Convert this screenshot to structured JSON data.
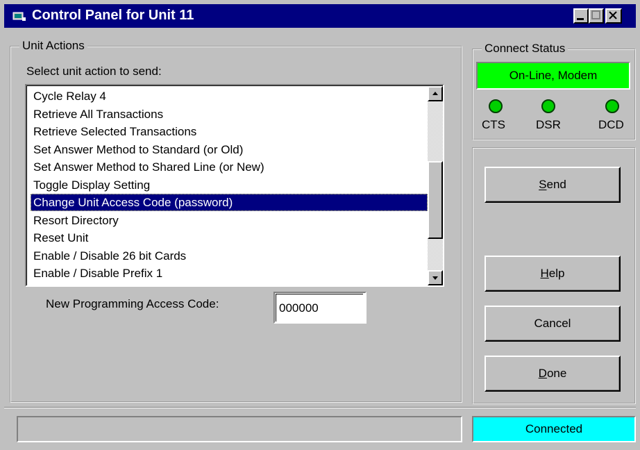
{
  "window": {
    "title": "Control Panel for Unit 11"
  },
  "unit_actions": {
    "group_label": "Unit Actions",
    "prompt": "Select unit action to send:",
    "items": [
      "Cycle Relay 4",
      "Retrieve All Transactions",
      "Retrieve Selected Transactions",
      "Set Answer Method to Standard (or Old)",
      "Set Answer Method to Shared Line (or New)",
      "Toggle Display Setting",
      "Change Unit Access Code (password)",
      "Resort Directory",
      "Reset Unit",
      "Enable / Disable 26 bit Cards",
      "Enable / Disable Prefix 1"
    ],
    "selected_index": 6,
    "access_code_label": "New Programming Access Code:",
    "access_code_value": "000000"
  },
  "connect_status": {
    "group_label": "Connect Status",
    "status_text": "On-Line, Modem",
    "status_color": "#00ff00",
    "indicators": [
      "CTS",
      "DSR",
      "DCD"
    ],
    "indicator_color": "#00d000"
  },
  "buttons": {
    "send": "Send",
    "help": "Help",
    "cancel": "Cancel",
    "done": "Done"
  },
  "statusbar": {
    "left_text": "",
    "right_text": "Connected",
    "right_color": "#00ffff"
  }
}
